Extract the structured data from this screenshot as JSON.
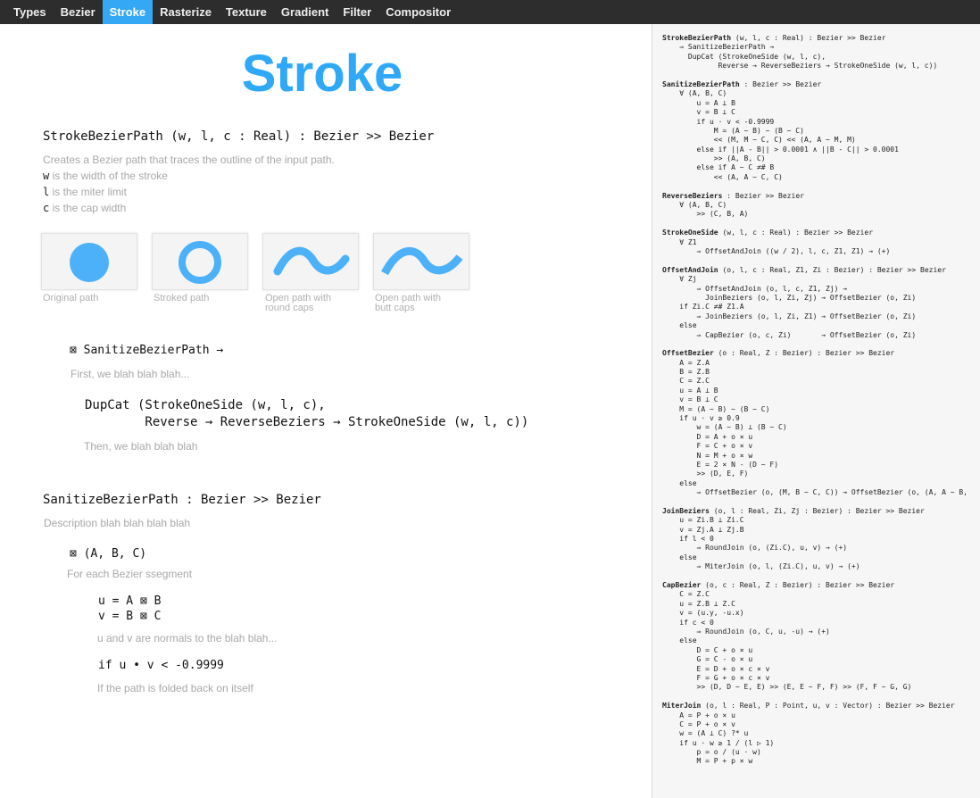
{
  "nav": {
    "tabs": [
      "Types",
      "Bezier",
      "Stroke",
      "Rasterize",
      "Texture",
      "Gradient",
      "Filter",
      "Compositor"
    ],
    "active": "Stroke"
  },
  "title": "Stroke",
  "stroke_bezier": {
    "signature": "StrokeBezierPath (w, l, c : Real) : Bezier >> Bezier",
    "description": "Creates a Bezier path that traces the outline of the input path.",
    "params": [
      {
        "name": "w",
        "text": " is the width of the stroke"
      },
      {
        "name": "l",
        "text": " is the miter limit"
      },
      {
        "name": "c",
        "text": " is the cap width"
      }
    ]
  },
  "thumbnails": [
    {
      "caption": "Original path"
    },
    {
      "caption": "Stroked path"
    },
    {
      "caption": "Open path with\nround caps"
    },
    {
      "caption": "Open path with\nbutt caps"
    }
  ],
  "sanitize_call": "⊠ SanitizeBezierPath →",
  "first_text": "First, we blah blah blah...",
  "dupcat_code": "DupCat (StrokeOneSide (w, l, c),\n        Reverse → ReverseBeziers → StrokeOneSide (w, l, c))",
  "then_text": "Then, we blah blah blah",
  "sanitize": {
    "signature": "SanitizeBezierPath : Bezier >> Bezier",
    "description": "Description blah blah blah blah",
    "forall": "⊠ (A, B, C)",
    "foreach": "For each Bezier ssegment",
    "uv": "u = A ⊠ B\nv = B ⊠ C",
    "uv_desc": "u and v are normals to the blah blah...",
    "if": "if u • v < -0.9999",
    "if_desc": "If the path is folded back on itself"
  },
  "colors": {
    "accent": "#35a8f5",
    "nav_bg": "#2d2d2d",
    "title": "#2fa9f7"
  },
  "side_code": [
    [
      "StrokeBezierPath",
      " (w, l, c : Real) : Bezier >> Bezier"
    ],
    [
      "",
      "    ⇒ SanitizeBezierPath →"
    ],
    [
      "",
      "      DupCat (StrokeOneSide (w, l, c),"
    ],
    [
      "",
      "             Reverse → ReverseBeziers → StrokeOneSide (w, l, c))"
    ],
    [
      "",
      ""
    ],
    [
      "SanitizeBezierPath",
      " : Bezier >> Bezier"
    ],
    [
      "",
      "    ∀ (A, B, C)"
    ],
    [
      "",
      "        u = A ⊥ B"
    ],
    [
      "",
      "        v = B ⊥ C"
    ],
    [
      "",
      "        if u · v < -0.9999"
    ],
    [
      "",
      "            M = (A ~ B) ~ (B ~ C)"
    ],
    [
      "",
      "            << (M, M ~ C, C) << (A, A ~ M, M)"
    ],
    [
      "",
      "        else if ||A - B|| > 0.0001 ∧ ||B - C|| > 0.0001"
    ],
    [
      "",
      "            >> (A, B, C)"
    ],
    [
      "",
      "        else if A ~ C ≠# B"
    ],
    [
      "",
      "            << (A, A ~ C, C)"
    ],
    [
      "",
      ""
    ],
    [
      "ReverseBeziers",
      " : Bezier >> Bezier"
    ],
    [
      "",
      "    ∀ (A, B, C)"
    ],
    [
      "",
      "        >> (C, B, A)"
    ],
    [
      "",
      ""
    ],
    [
      "StrokeOneSide",
      " (w, l, c : Real) : Bezier >> Bezier"
    ],
    [
      "",
      "    ∀ Z1"
    ],
    [
      "",
      "        ⇒ OffsetAndJoin ((w / 2), l, c, Z1, Z1) → (+)"
    ],
    [
      "",
      ""
    ],
    [
      "OffsetAndJoin",
      " (o, l, c : Real, Z1, Zi : Bezier) : Bezier >> Bezier"
    ],
    [
      "",
      "    ∀ Zj"
    ],
    [
      "",
      "        ⇒ OffsetAndJoin (o, l, c, Z1, Zj) →"
    ],
    [
      "",
      "          JoinBeziers (o, l, Zi, Zj) → OffsetBezier (o, Zi)"
    ],
    [
      "",
      "    if Zi.C ≠# Z1.A"
    ],
    [
      "",
      "        ⇒ JoinBeziers (o, l, Zi, Z1) → OffsetBezier (o, Zi)"
    ],
    [
      "",
      "    else"
    ],
    [
      "",
      "        ⇒ CapBezier (o, c, Zi)       → OffsetBezier (o, Zi)"
    ],
    [
      "",
      ""
    ],
    [
      "OffsetBezier",
      " (o : Real, Z : Bezier) : Bezier >> Bezier"
    ],
    [
      "",
      "    A = Z.A"
    ],
    [
      "",
      "    B = Z.B"
    ],
    [
      "",
      "    C = Z.C"
    ],
    [
      "",
      "    u = A ⊥ B"
    ],
    [
      "",
      "    v = B ⊥ C"
    ],
    [
      "",
      "    M = (A ~ B) ~ (B ~ C)"
    ],
    [
      "",
      "    if u · v ≥ 0.9"
    ],
    [
      "",
      "        w = (A ~ B) ⊥ (B ~ C)"
    ],
    [
      "",
      "        D = A + o × u"
    ],
    [
      "",
      "        F = C + o × v"
    ],
    [
      "",
      "        N = M + o × w"
    ],
    [
      "",
      "        E = 2 × N - (D ~ F)"
    ],
    [
      "",
      "        >> (D, E, F)"
    ],
    [
      "",
      "    else"
    ],
    [
      "",
      "        ⇒ OffsetBezier (o, (M, B ~ C, C)) → OffsetBezier (o, (A, A ~ B,"
    ],
    [
      "",
      ""
    ],
    [
      "JoinBeziers",
      " (o, l : Real, Zi, Zj : Bezier) : Bezier >> Bezier"
    ],
    [
      "",
      "    u = Zi.B ⊥ Zi.C"
    ],
    [
      "",
      "    v = Zj.A ⊥ Zj.B"
    ],
    [
      "",
      "    if l < 0"
    ],
    [
      "",
      "        ⇒ RoundJoin (o, (Zi.C), u, v) → (+)"
    ],
    [
      "",
      "    else"
    ],
    [
      "",
      "        ⇒ MiterJoin (o, l, (Zi.C), u, v) → (+)"
    ],
    [
      "",
      ""
    ],
    [
      "CapBezier",
      " (o, c : Real, Z : Bezier) : Bezier >> Bezier"
    ],
    [
      "",
      "    C = Z.C"
    ],
    [
      "",
      "    u = Z.B ⊥ Z.C"
    ],
    [
      "",
      "    v = (u.y, -u.x)"
    ],
    [
      "",
      "    if c < 0"
    ],
    [
      "",
      "        ⇒ RoundJoin (o, C, u, -u) → (+)"
    ],
    [
      "",
      "    else"
    ],
    [
      "",
      "        D = C + o × u"
    ],
    [
      "",
      "        G = C - o × u"
    ],
    [
      "",
      "        E = D + o × c × v"
    ],
    [
      "",
      "        F = G + o × c × v"
    ],
    [
      "",
      "        >> (D, D ~ E, E) >> (E, E ~ F, F) >> (F, F ~ G, G)"
    ],
    [
      "",
      ""
    ],
    [
      "MiterJoin",
      " (o, l : Real, P : Point, u, v : Vector) : Bezier >> Bezier"
    ],
    [
      "",
      "    A = P + o × u"
    ],
    [
      "",
      "    C = P + o × v"
    ],
    [
      "",
      "    w = (A ⊥ C) ?* u"
    ],
    [
      "",
      "    if u · w ≥ 1 / (l ▷ 1)"
    ],
    [
      "",
      "        p = o / (u · w)"
    ],
    [
      "",
      "        M = P + p × w"
    ]
  ]
}
